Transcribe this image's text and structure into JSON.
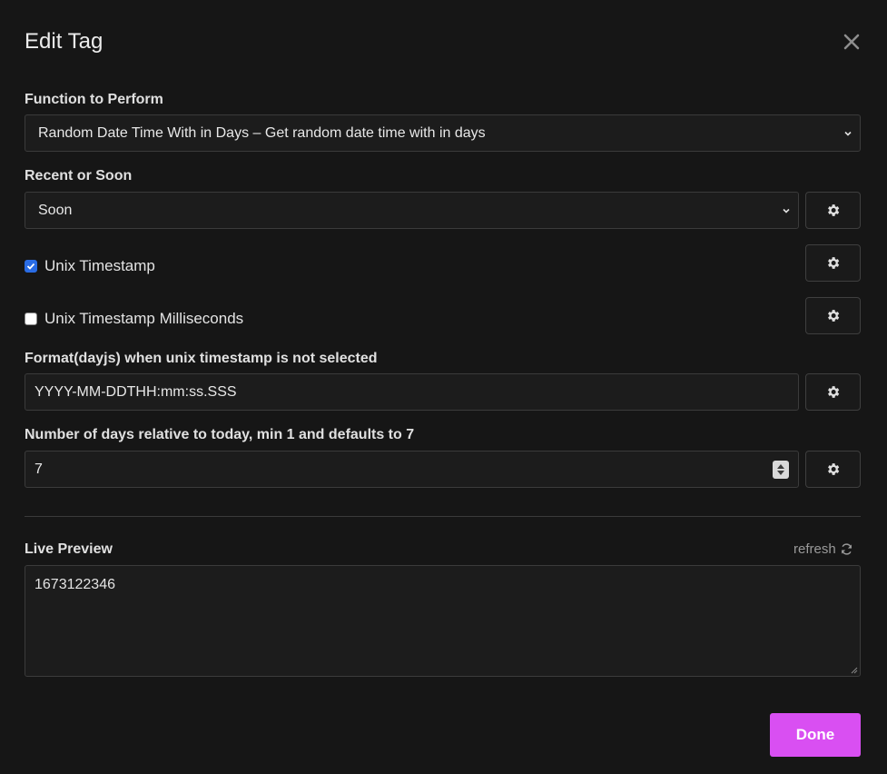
{
  "dialog": {
    "title": "Edit Tag",
    "close_icon": "close-icon"
  },
  "function": {
    "label": "Function to Perform",
    "selected": "Random Date Time With in Days – Get random date time with in days"
  },
  "recent_or_soon": {
    "label": "Recent or Soon",
    "selected": "Soon"
  },
  "unix_timestamp": {
    "label": "Unix Timestamp",
    "checked": true
  },
  "unix_timestamp_ms": {
    "label": "Unix Timestamp Milliseconds",
    "checked": false
  },
  "format": {
    "label": "Format(dayjs) when unix timestamp is not selected",
    "value": "YYYY-MM-DDTHH:mm:ss.SSS"
  },
  "days": {
    "label": "Number of days relative to today, min 1 and defaults to 7",
    "value": "7"
  },
  "live_preview": {
    "label": "Live Preview",
    "refresh_label": "refresh",
    "value": "1673122346"
  },
  "done_label": "Done",
  "colors": {
    "accent": "#d94ff2",
    "checkbox": "#2a6ce4",
    "background": "#161616"
  },
  "icons": {
    "settings": "gear-icon",
    "refresh": "refresh-icon",
    "dropdown": "chevron-down-icon"
  }
}
